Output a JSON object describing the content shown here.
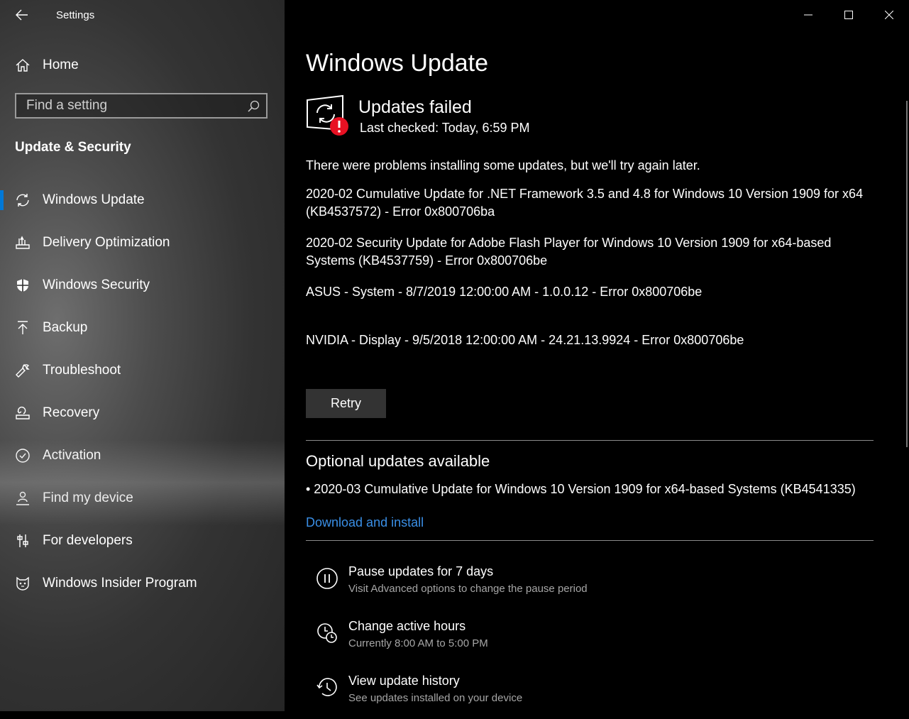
{
  "window": {
    "title": "Settings"
  },
  "sidebar": {
    "home_label": "Home",
    "search_placeholder": "Find a setting",
    "section_heading": "Update & Security",
    "items": [
      {
        "label": "Windows Update",
        "icon": "sync-icon",
        "selected": true
      },
      {
        "label": "Delivery Optimization",
        "icon": "delivery-optimization-icon"
      },
      {
        "label": "Windows Security",
        "icon": "shield-icon"
      },
      {
        "label": "Backup",
        "icon": "backup-arrow-icon"
      },
      {
        "label": "Troubleshoot",
        "icon": "wrench-icon"
      },
      {
        "label": "Recovery",
        "icon": "recovery-icon"
      },
      {
        "label": "Activation",
        "icon": "check-circle-icon"
      },
      {
        "label": "Find my device",
        "icon": "person-location-icon"
      },
      {
        "label": "For developers",
        "icon": "developer-sliders-icon"
      },
      {
        "label": "Windows Insider Program",
        "icon": "insider-cat-icon"
      }
    ]
  },
  "main": {
    "page_title": "Windows Update",
    "status": {
      "title": "Updates failed",
      "last_checked": "Last checked: Today, 6:59 PM"
    },
    "problem_message": "There were problems installing some updates, but we'll try again later.",
    "failed_updates": [
      "2020-02 Cumulative Update for .NET Framework 3.5 and 4.8 for Windows 10 Version 1909 for x64 (KB4537572) - Error 0x800706ba",
      "2020-02 Security Update for Adobe Flash Player for Windows 10 Version 1909 for x64-based Systems (KB4537759) - Error 0x800706be",
      "ASUS - System - 8/7/2019 12:00:00 AM - 1.0.0.12 - Error 0x800706be",
      "NVIDIA - Display - 9/5/2018 12:00:00 AM - 24.21.13.9924 - Error 0x800706be"
    ],
    "retry_label": "Retry",
    "optional": {
      "heading": "Optional updates available",
      "item": "• 2020-03 Cumulative Update for Windows 10 Version 1909 for x64-based Systems (KB4541335)",
      "link": "Download and install"
    },
    "options": [
      {
        "title": "Pause updates for 7 days",
        "subtitle": "Visit Advanced options to change the pause period"
      },
      {
        "title": "Change active hours",
        "subtitle": "Currently 8:00 AM to 5:00 PM"
      },
      {
        "title": "View update history",
        "subtitle": "See updates installed on your device"
      }
    ]
  },
  "colors": {
    "accent": "#0078d7",
    "link": "#3a8fe6",
    "error": "#e81123"
  }
}
